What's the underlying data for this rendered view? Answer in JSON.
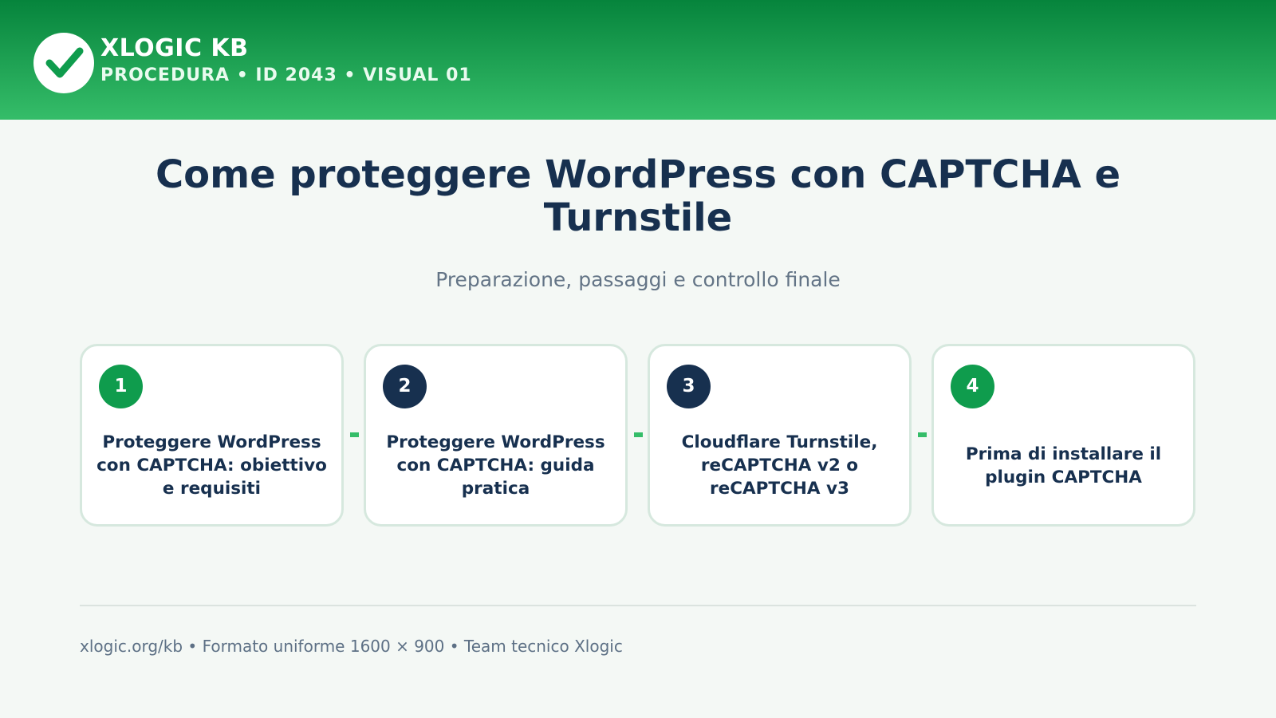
{
  "header": {
    "brand": "XLOGIC KB",
    "subtitle": "PROCEDURA • ID 2043 • VISUAL 01",
    "logo_icon": "checkmark-icon",
    "colors": {
      "gradient_top": "#06843c",
      "gradient_bottom": "#35bd69"
    }
  },
  "main": {
    "title": "Come proteggere WordPress con CAPTCHA e Turnstile",
    "subtitle": "Preparazione, passaggi e controllo finale"
  },
  "steps": [
    {
      "number": "1",
      "text": "Proteggere WordPress con CAPTCHA: obiettivo e requisiti",
      "badge_color": "#0f9c4d"
    },
    {
      "number": "2",
      "text": "Proteggere WordPress con CAPTCHA: guida pratica",
      "badge_color": "#17304f"
    },
    {
      "number": "3",
      "text": "Cloudflare Turnstile, reCAPTCHA v2 o reCAPTCHA v3",
      "badge_color": "#17304f"
    },
    {
      "number": "4",
      "text": "Prima di installare il plugin CAPTCHA",
      "badge_color": "#0f9c4d"
    }
  ],
  "footer": {
    "text": "xlogic.org/kb • Formato uniforme 1600 × 900 • Team tecnico Xlogic"
  }
}
